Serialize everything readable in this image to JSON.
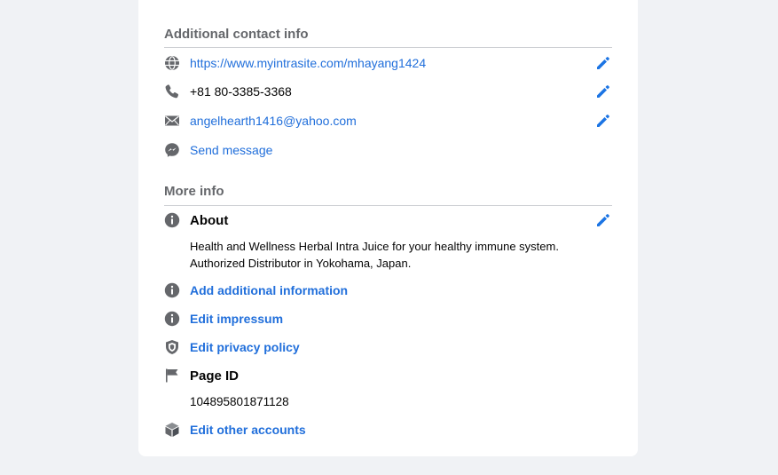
{
  "contact": {
    "section_title": "Additional contact info",
    "website": "https://www.myintrasite.com/mhayang1424",
    "phone": "+81 80-3385-3368",
    "email": "angelhearth1416@yahoo.com",
    "send_message": "Send message"
  },
  "more_info": {
    "section_title": "More info",
    "about_label": "About",
    "about_line1": "Health and Wellness Herbal Intra Juice for your healthy immune system.",
    "about_line2": "Authorized Distributor in Yokohama, Japan.",
    "add_additional": "Add additional information",
    "edit_impressum": "Edit impressum",
    "edit_privacy": "Edit privacy policy",
    "page_id_label": "Page ID",
    "page_id_value": "104895801871128",
    "edit_other_accounts": "Edit other accounts"
  },
  "colors": {
    "accent": "#216fdb",
    "icon_gray": "#65676b",
    "background": "#f0f2f5"
  },
  "icons": [
    "globe-icon",
    "phone-icon",
    "mail-icon",
    "messenger-icon",
    "info-icon",
    "shield-icon",
    "flag-icon",
    "cube-icon",
    "pencil-icon"
  ]
}
